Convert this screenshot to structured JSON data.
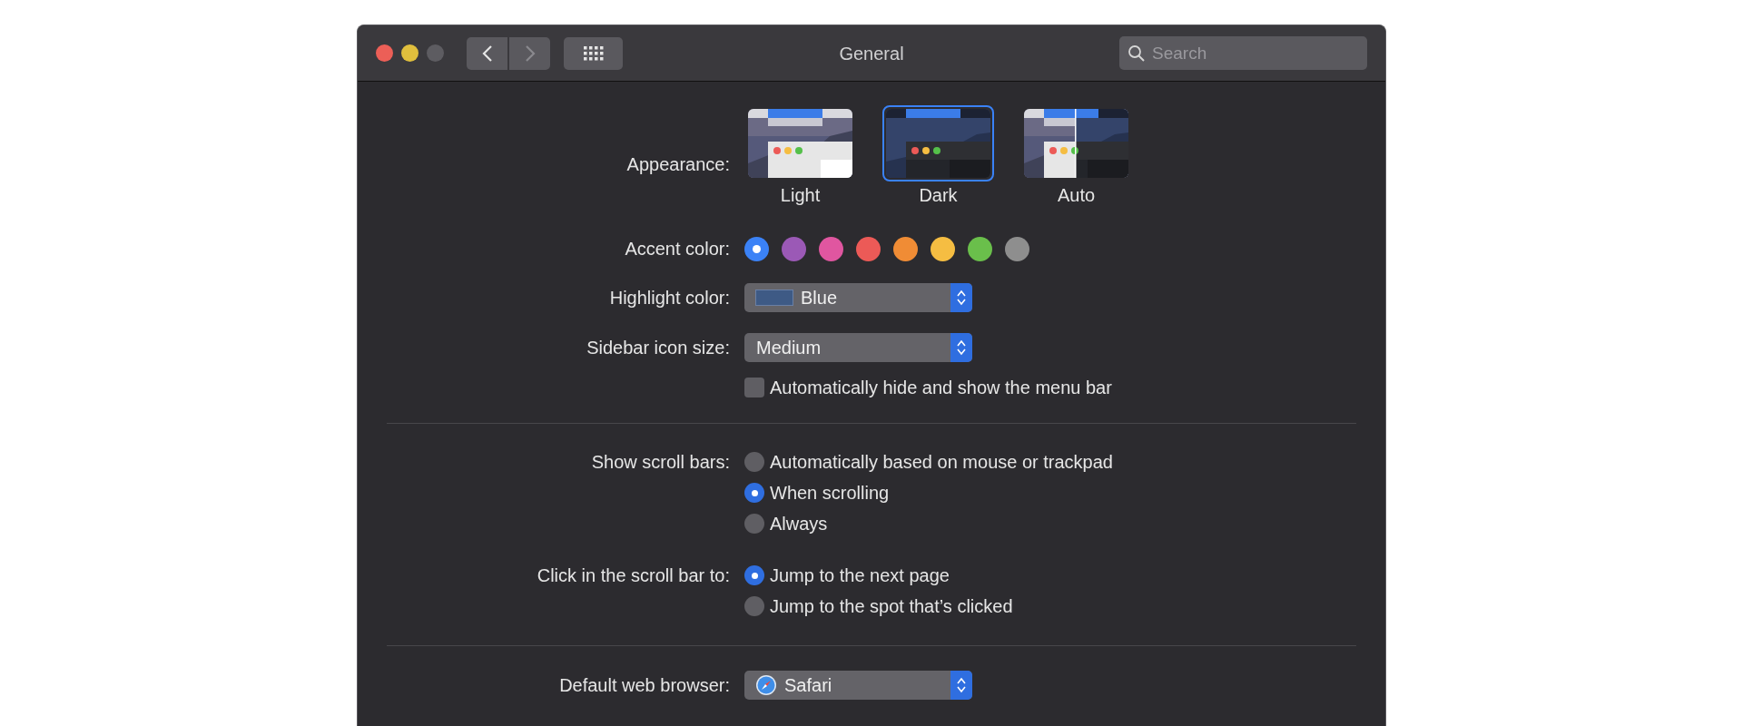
{
  "window": {
    "title": "General",
    "window_buttons": [
      {
        "kind": "close",
        "disabled": false
      },
      {
        "kind": "minimize",
        "disabled": false
      },
      {
        "kind": "zoom",
        "disabled": true
      }
    ],
    "nav": {
      "back": {
        "disabled": false
      },
      "forward": {
        "disabled": true
      }
    },
    "search": {
      "placeholder": "Search"
    }
  },
  "appearance": {
    "label": "Appearance:",
    "options": [
      {
        "label": "Light",
        "kind": "light",
        "selected": false
      },
      {
        "label": "Dark",
        "kind": "dark",
        "selected": true
      },
      {
        "label": "Auto",
        "kind": "auto",
        "selected": false
      }
    ]
  },
  "accent_color": {
    "label": "Accent color:",
    "swatches": [
      {
        "color": "#3b82f6",
        "selected": true
      },
      {
        "color": "#9b59b6",
        "selected": false
      },
      {
        "color": "#e056a0",
        "selected": false
      },
      {
        "color": "#ec5a57",
        "selected": false
      },
      {
        "color": "#f08c35",
        "selected": false
      },
      {
        "color": "#f5bd42",
        "selected": false
      },
      {
        "color": "#6abf4b",
        "selected": false
      },
      {
        "color": "#8e8e8e",
        "selected": false
      }
    ]
  },
  "highlight_color": {
    "label": "Highlight color:",
    "value": "Blue"
  },
  "sidebar_icon_size": {
    "label": "Sidebar icon size:",
    "value": "Medium"
  },
  "menu_bar": {
    "label": "Automatically hide and show the menu bar",
    "checked": false
  },
  "scroll_bars": {
    "label": "Show scroll bars:",
    "options": [
      {
        "label": "Automatically based on mouse or trackpad",
        "selected": false
      },
      {
        "label": "When scrolling",
        "selected": true
      },
      {
        "label": "Always",
        "selected": false
      }
    ]
  },
  "click_scroll_bar": {
    "label": "Click in the scroll bar to:",
    "options": [
      {
        "label": "Jump to the next page",
        "selected": true
      },
      {
        "label": "Jump to the spot that’s clicked",
        "selected": false
      }
    ]
  },
  "default_browser": {
    "label": "Default web browser:",
    "value": "Safari"
  }
}
